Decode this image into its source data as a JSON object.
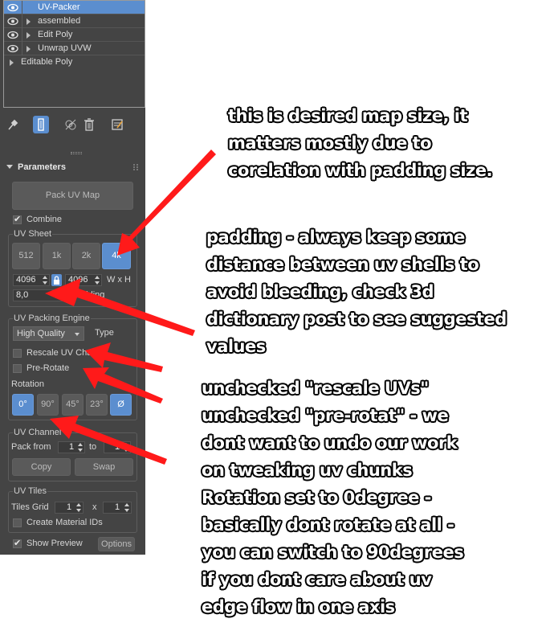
{
  "stack": {
    "items": [
      {
        "label": "UV-Packer",
        "eye": true,
        "expander": false,
        "selected": true
      },
      {
        "label": "assembled",
        "eye": true,
        "expander": true,
        "selected": false
      },
      {
        "label": "Edit Poly",
        "eye": true,
        "expander": true,
        "selected": false
      },
      {
        "label": "Unwrap UVW",
        "eye": true,
        "expander": true,
        "selected": false
      },
      {
        "label": "Editable Poly",
        "eye": false,
        "expander": true,
        "selected": false
      }
    ]
  },
  "toolbar": {
    "icons": [
      "pin-icon",
      "show-end-result-icon",
      "make-unique-icon",
      "remove-modifier-icon",
      "configure-modifier-sets-icon"
    ]
  },
  "parameters": {
    "header": "Parameters",
    "pack_button": "Pack UV Map",
    "combine_label": "Combine",
    "combine_checked": true,
    "uv_sheet": {
      "title": "UV Sheet",
      "sizes": [
        "512",
        "1k",
        "2k",
        "4k"
      ],
      "selected_size": "4k",
      "width": "4096",
      "height": "4096",
      "wxh_label": "W x H",
      "padding_value": "8,0",
      "padding_label": "Padding"
    },
    "engine": {
      "title": "UV Packing Engine",
      "quality_value": "High Quality",
      "type_label": "Type",
      "rescale_label": "Rescale UV Charts",
      "rescale_checked": false,
      "prerotate_label": "Pre-Rotate",
      "prerotate_checked": false,
      "rotation_label": "Rotation",
      "rotations": [
        "0°",
        "90°",
        "45°",
        "23°",
        "Ø"
      ],
      "rotation_selected": "0°"
    },
    "channel": {
      "title": "UV Channel Control",
      "pack_from_label": "Pack from",
      "from_value": "1",
      "to_label": "to",
      "to_value": "1",
      "copy_label": "Copy",
      "swap_label": "Swap"
    },
    "tiles": {
      "title": "UV Tiles",
      "grid_label": "Tiles Grid",
      "grid_x": "1",
      "x_label": "x",
      "grid_y": "1",
      "material_ids_label": "Create Material IDs",
      "material_ids_checked": false
    },
    "show_preview_label": "Show Preview",
    "show_preview_checked": true,
    "options_label": "Options"
  },
  "annotations": {
    "map_size": [
      "this is desired map size, it",
      "matters mostly due to",
      "corelation with padding size."
    ],
    "padding": [
      "padding - always keep some",
      "distance between uv shells to",
      "avoid bleeding, check 3d",
      "dictionary post to see suggested",
      "values"
    ],
    "rotation": [
      "unchecked \"rescale UVs\"",
      "unchecked \"pre-rotat\" - we",
      "dont want to undo our work",
      "on tweaking uv chunks",
      "Rotation set to 0degree -",
      "basically dont rotate at all -",
      "you can switch to 90degrees",
      "if you dont care about uv",
      "edge flow in one axis"
    ]
  },
  "colors": {
    "accent": "#5b8ecf",
    "panel": "#444444",
    "arrow": "#ff1a1a"
  }
}
